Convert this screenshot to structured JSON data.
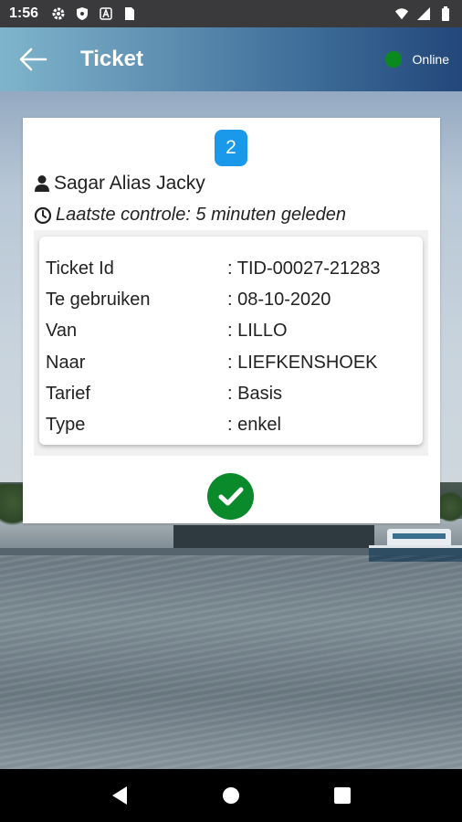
{
  "status_bar": {
    "time": "1:56",
    "icons_left": [
      "settings-icon",
      "shield-icon",
      "a-icon",
      "sim-icon"
    ],
    "icons_right": [
      "wifi-icon",
      "signal-icon",
      "battery-icon"
    ]
  },
  "header": {
    "title": "Ticket",
    "status_label": "Online",
    "status_color": "#0a8a1e"
  },
  "card": {
    "badge": "2",
    "badge_color": "#1a99ea",
    "user_name": "Sagar Alias Jacky",
    "last_check": "Laatste controle: 5 minuten geleden",
    "details": [
      {
        "label": "Ticket Id",
        "value": ": TID-00027-21283"
      },
      {
        "label": "Te gebruiken",
        "value": ": 08-10-2020"
      },
      {
        "label": "Van",
        "value": ": LILLO"
      },
      {
        "label": "Naar",
        "value": ": LIEFKENSHOEK"
      },
      {
        "label": "Tarief",
        "value": ": Basis"
      },
      {
        "label": "Type",
        "value": ": enkel"
      }
    ],
    "validated_color": "#0a8a2a"
  },
  "nav": {
    "buttons": [
      "back-icon",
      "home-icon",
      "recents-icon"
    ]
  }
}
